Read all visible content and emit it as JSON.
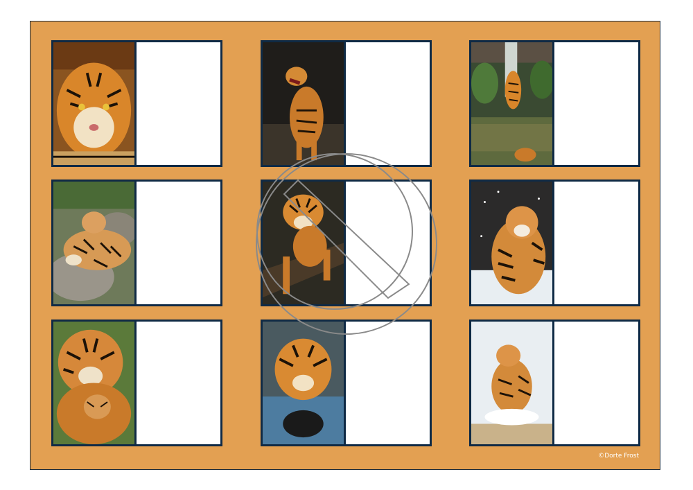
{
  "board": {
    "background_color": "#E3A052",
    "card_border_color": "#0f2a45",
    "copyright": "©Dorte Frost"
  },
  "cards": [
    {
      "icon": "tiger-face-closeup-photo"
    },
    {
      "icon": "tiger-roaring-standing-photo"
    },
    {
      "icon": "tiger-waterfall-photo"
    },
    {
      "icon": "tiger-lying-on-rocks-photo"
    },
    {
      "icon": "tiger-on-log-photo"
    },
    {
      "icon": "tiger-in-snow-photo"
    },
    {
      "icon": "tiger-mother-and-cub-photo"
    },
    {
      "icon": "tiger-swimming-photo"
    },
    {
      "icon": "tiger-running-in-snow-photo"
    }
  ]
}
